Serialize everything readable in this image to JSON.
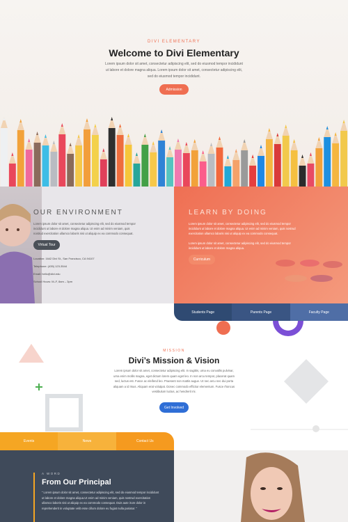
{
  "hero": {
    "kicker": "DIVI ELEMENTARY",
    "title": "Welcome to Divi Elementary",
    "lead": "Lorem ipsum dolor sit amet, consectetur adipiscing elit, sed do eiusmod tempor incididunt ut labore et dolore magna aliqua. Lorem ipsum dolor sit amet, consectetur adipiscing elit, sed do eiusmod tempor incididunt.",
    "button": "Admission",
    "pencil_colors": [
      "#eef0f2",
      "#e9475b",
      "#f2a23a",
      "#f06a9c",
      "#8b6b5c",
      "#3dbde6",
      "#b9bcc2",
      "#e9475b",
      "#8a6a5a",
      "#f5c84a",
      "#f29e3b",
      "#f3d14b",
      "#e0405a",
      "#2f2f2f",
      "#ee6d3d",
      "#f6c63a",
      "#26a69a",
      "#43a047",
      "#f7c84a",
      "#2f83d6",
      "#55c4c0",
      "#f07ab0",
      "#e9475b",
      "#f2a23a",
      "#fb5d8b",
      "#b9bcc2",
      "#f2683c",
      "#23a8d6",
      "#f5a26a",
      "#9a9a9a",
      "#e53e3e",
      "#1e88e5",
      "#f5b640",
      "#d93a3a",
      "#f2c94c",
      "#f5c041",
      "#2b2b2b",
      "#e84a64",
      "#f2a23a",
      "#1e90e0",
      "#f5b640",
      "#f2c94c"
    ]
  },
  "environment": {
    "title": "OUR ENVIRONMENT",
    "body": "Lorem ipsum dolor sit amet, consectetur adipiscing elit, sed do eiusmod tempor incididunt ut labore et dolore magna aliqua. Ut enim ad minim veniam, quis nostrud exercitation ullamco laboris nisi ut aliquip ex ea commodo consequat.",
    "button": "Virtual Tour",
    "location": "Location: 1642 Divi St., San Francisco, CA 94107",
    "telephone": "Telephone: (435) 123-3544",
    "email": "Email: hello@divi.edu",
    "hours": "School Hours: M–F, 8am – 3pm"
  },
  "learn": {
    "title": "LEARN BY DOING",
    "p1": "Lorem ipsum dolor sit amet, consectetur adipiscing elit, sed do eiusmod tempor incididunt ut labore et dolore magna aliqua. Ut enim ad minim veniam, quis nostrud exercitation ullamco laboris nisi ut aliquip ex ea commodo consequat.",
    "p2": "Lorem ipsum dolor sit amet, consectetur adipiscing elit, sed do eiusmod tempor incididunt ut labore et dolore magna aliqua.",
    "button": "Curriculum"
  },
  "pages_tabs": [
    {
      "label": "Students Page",
      "color": "#2f4a72"
    },
    {
      "label": "Parents Page",
      "color": "#3a5583"
    },
    {
      "label": "Faculty Page",
      "color": "#4f6ea6"
    }
  ],
  "mission": {
    "kicker": "MISSION",
    "title": "Divi’s Mission & Vision",
    "body": "Lorem ipsum dolor sit amet, consectetur adipiscing elit. In sagittis, urna eu convallis pulvinar, urna enim mollis magna, eget dictum lorem quam eget leo. In non arcu tempor, placerat quam sed, luctus est. Fusce ac eleifend leo. Praesent non mattis augue. Ut nec arcu nec dui porta aliquam a id risus. Aliquam erat volutpat. Donec commodo efficitur elementum. Fusce rhoncus vestibulum luctus, ac hendrerit mi.",
    "button": "Get Involved"
  },
  "bottom_tabs": [
    {
      "label": "Events",
      "color": "#f5a623"
    },
    {
      "label": "News",
      "color": "#f7b23b"
    },
    {
      "label": "Contact Us",
      "color": "#f59a1f"
    }
  ],
  "principal": {
    "kicker": "A WORD",
    "title": "From Our Principal",
    "quote": "“ Lorem ipsum dolor sit amet, consectetur adipiscing elit, sed do eiusmod tempor incididunt ut labore et dolore magna aliqua.Ut enim ad minim veniam, quis nostrud exercitation ullamco laboris nisi ut aliquip ex ea commodo consequat. Duis aute irure dolor in reprehenderit in voluptate velit esse cillum dolore eu fugiat nulla pariatur. ”"
  },
  "colors": {
    "accent": "#ef6e51",
    "blue": "#2f6ed6",
    "orange": "#f5a623",
    "slate": "#3f4a5a"
  }
}
